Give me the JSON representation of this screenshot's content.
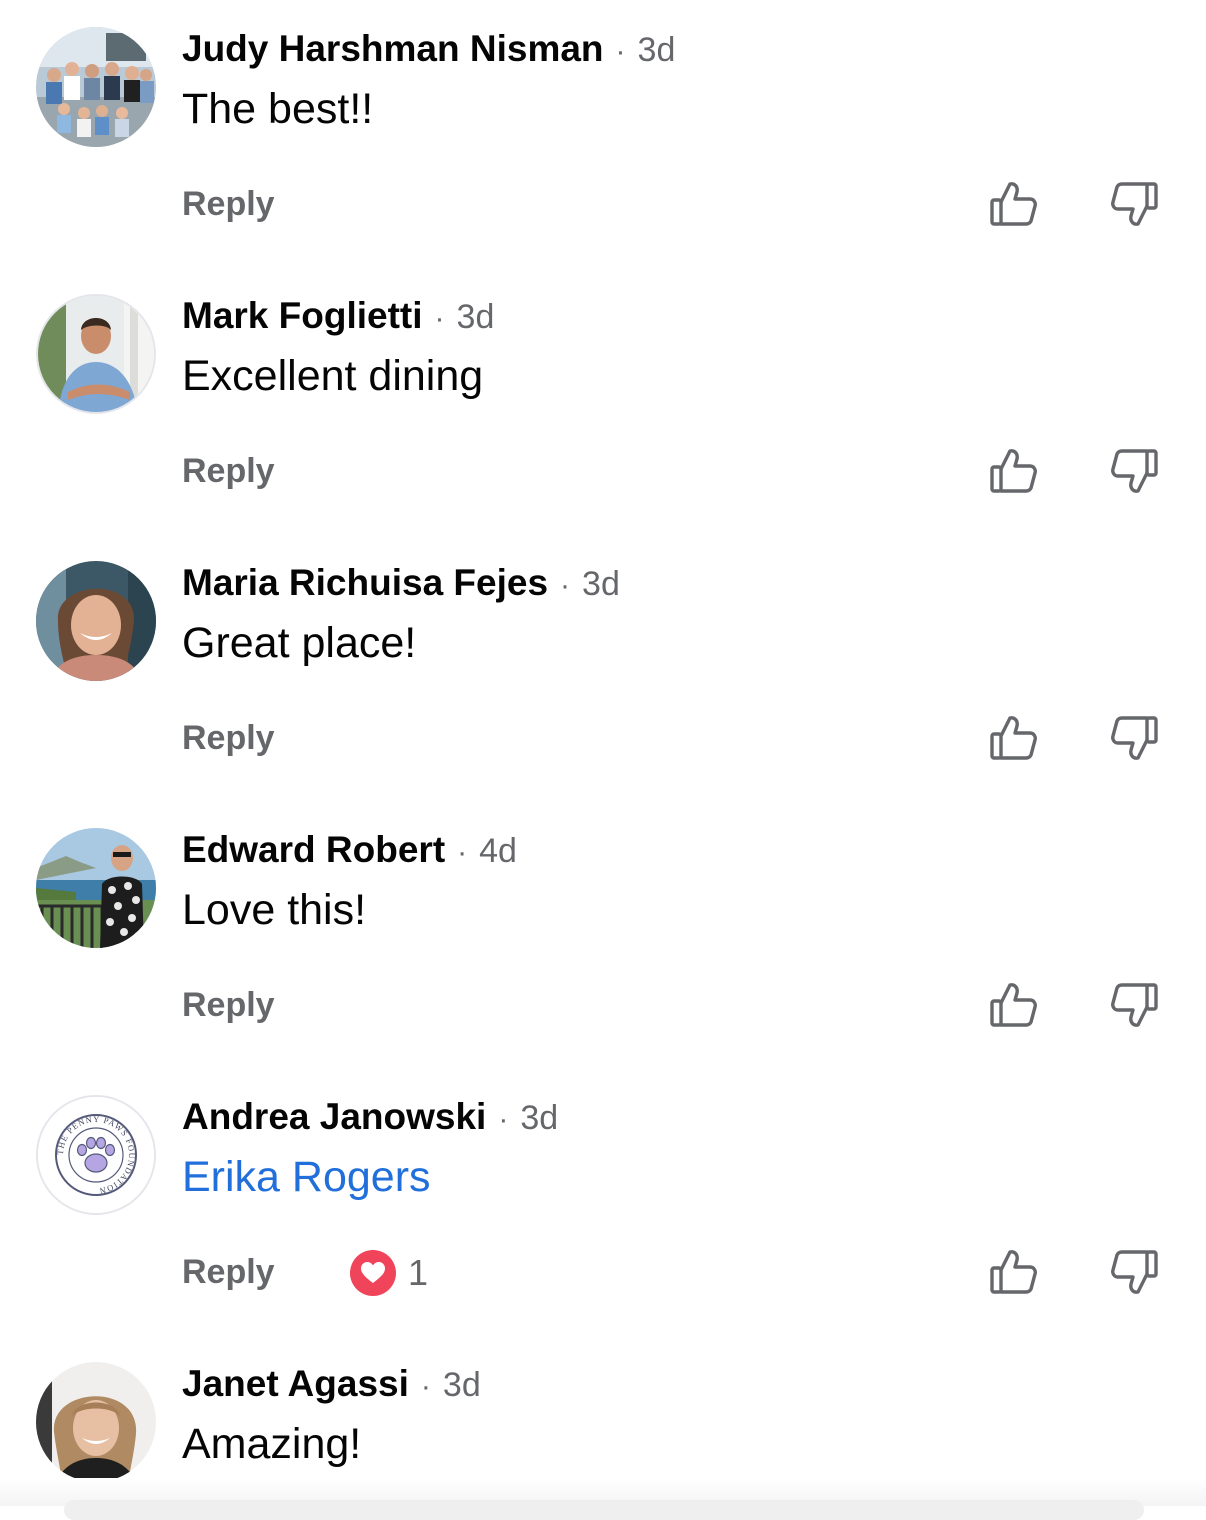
{
  "comments": [
    {
      "name": "Judy Harshman Nisman",
      "separator": "·",
      "time": "3d",
      "text": "The best!!",
      "reply_label": "Reply",
      "like_icon": "thumbs-up-icon",
      "dislike_icon": "thumbs-down-icon"
    },
    {
      "name": "Mark Foglietti",
      "separator": "·",
      "time": "3d",
      "text": "Excellent dining",
      "reply_label": "Reply",
      "like_icon": "thumbs-up-icon",
      "dislike_icon": "thumbs-down-icon"
    },
    {
      "name": "Maria Richuisa Fejes",
      "separator": "·",
      "time": "3d",
      "text": "Great place!",
      "reply_label": "Reply",
      "like_icon": "thumbs-up-icon",
      "dislike_icon": "thumbs-down-icon"
    },
    {
      "name": "Edward Robert",
      "separator": "·",
      "time": "4d",
      "text": "Love this!",
      "reply_label": "Reply",
      "like_icon": "thumbs-up-icon",
      "dislike_icon": "thumbs-down-icon"
    },
    {
      "name": "Andrea Janowski",
      "separator": "·",
      "time": "3d",
      "text": "Erika Rogers",
      "text_is_tag": true,
      "reply_label": "Reply",
      "reaction": {
        "icon": "heart-icon",
        "count": "1"
      },
      "avatar_logo_text": "THE PENNY PAWS FOUNDATION",
      "like_icon": "thumbs-up-icon",
      "dislike_icon": "thumbs-down-icon"
    },
    {
      "name": "Janet Agassi",
      "separator": "·",
      "time": "3d",
      "text": "Amazing!",
      "like_icon": "thumbs-up-icon",
      "dislike_icon": "thumbs-down-icon"
    }
  ],
  "colors": {
    "name": "#050505",
    "meta": "#65676b",
    "tag_link": "#216fdb",
    "heart_reaction": "#f0445b",
    "icon_stroke": "#65676b"
  }
}
